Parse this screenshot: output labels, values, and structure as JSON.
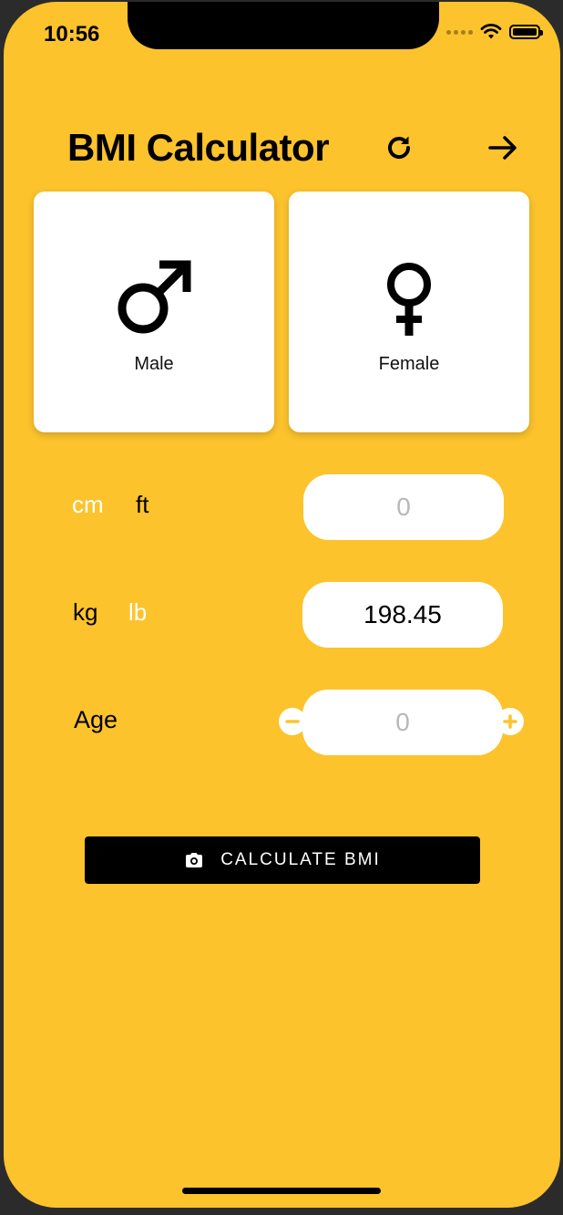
{
  "status_bar": {
    "time": "10:56"
  },
  "header": {
    "title": "BMI Calculator",
    "refresh_icon": "refresh-icon",
    "next_icon": "arrow-right-icon"
  },
  "gender": {
    "male_label": "Male",
    "female_label": "Female",
    "male_icon": "male-symbol-icon",
    "female_icon": "female-symbol-icon"
  },
  "height": {
    "unit_cm": "cm",
    "unit_ft": "ft",
    "selected_unit": "ft",
    "placeholder": "0"
  },
  "weight": {
    "unit_kg": "kg",
    "unit_lb": "lb",
    "selected_unit": "kg",
    "value": "198.45"
  },
  "age": {
    "label": "Age",
    "placeholder": "0"
  },
  "calculate": {
    "label": "CALCULATE BMI",
    "icon": "camera-icon"
  },
  "colors": {
    "background": "#FCC32C",
    "card": "#FFFFFF",
    "button": "#000000"
  }
}
